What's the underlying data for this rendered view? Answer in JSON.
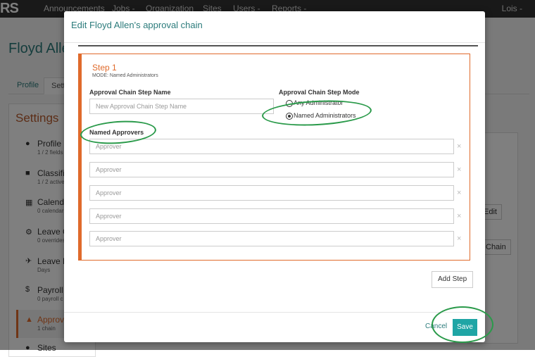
{
  "nav": {
    "brand": "RS",
    "items": [
      "Announcements",
      "Jobs -",
      "Organization",
      "Sites",
      "Users -",
      "Reports -"
    ],
    "user": "Lois -"
  },
  "employee": {
    "name": "Floyd Allen"
  },
  "tabs": [
    "Profile",
    "Sett"
  ],
  "settings": {
    "title": "Settings",
    "items": [
      {
        "icon": "user-icon",
        "label": "Profile",
        "sub": "1 / 2 fields"
      },
      {
        "icon": "folder-icon",
        "label": "Classific",
        "sub": "1 / 2 active"
      },
      {
        "icon": "calendar-icon",
        "label": "Calenda",
        "sub": "0 calendars"
      },
      {
        "icon": "gear-icon",
        "label": "Leave Co",
        "sub": "0 overrides"
      },
      {
        "icon": "plane-icon",
        "label": "Leave Ba",
        "sub": "Days"
      },
      {
        "icon": "dollar-icon",
        "label": "Payroll",
        "sub": "0 payroll c"
      },
      {
        "icon": "thumbs-up-icon",
        "label": "Approva",
        "sub": "1 chain"
      },
      {
        "icon": "map-pin-icon",
        "label": "Sites",
        "sub": ""
      }
    ]
  },
  "bg_buttons": {
    "edit": "Edit",
    "chain": "Chain"
  },
  "modal": {
    "title": "Edit Floyd Allen's approval chain",
    "step": {
      "title": "Step 1",
      "mode_text": "MODE: Named Administrators",
      "name_label": "Approval Chain Step Name",
      "name_placeholder": "New Approval Chain Step Name",
      "mode_label": "Approval Chain Step Mode",
      "modes": [
        "Any Administrator",
        "Named Administrators"
      ],
      "selected_mode": "Named Administrators",
      "approvers_label": "Named Approvers",
      "approver_placeholder": "Approver",
      "approvers_count": 5,
      "remove_icon": "×"
    },
    "add_step": "Add Step",
    "cancel": "Cancel",
    "save": "Save"
  },
  "colors": {
    "accent": "#e06a2b",
    "teal": "#1fa5a5",
    "annotation": "#2a9a4a"
  }
}
